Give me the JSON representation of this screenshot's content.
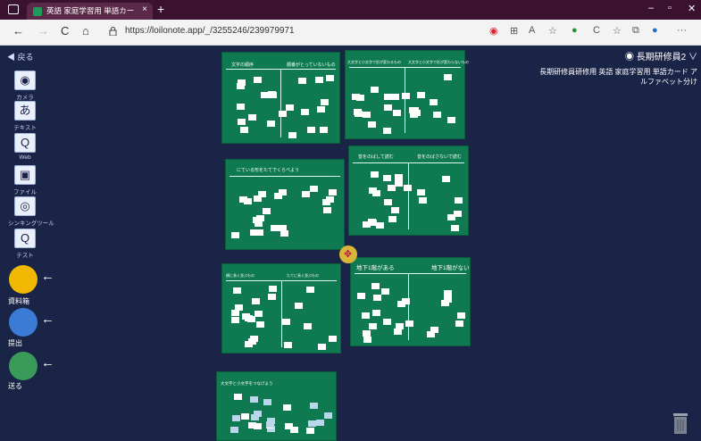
{
  "browser": {
    "tab_title": "英語 家庭学習用 単語カードア",
    "close_tab": "×",
    "new_tab": "+",
    "url": "https://loilonote.app/_/3255246/239979971",
    "window_controls": [
      "–",
      "▫",
      "✕"
    ],
    "nav": {
      "back": "←",
      "forward": "→",
      "reload": "C",
      "home": "⌂"
    },
    "toolbar_icons": [
      "tracking-icon",
      "grid-icon",
      "read-aloud-icon",
      "favorite-icon",
      "extension-icon",
      "refresh-icon",
      "favorites-bar-icon",
      "collections-icon",
      "profile-icon",
      "more-icon"
    ],
    "more_label": "···"
  },
  "app": {
    "back_label": "戻る",
    "tools": [
      {
        "label": "カメラ",
        "glyph": "◉",
        "icon": "camera-icon"
      },
      {
        "label": "テキスト",
        "glyph": "あ",
        "icon": "text-icon"
      },
      {
        "label": "Web",
        "glyph": "Q",
        "icon": "web-icon"
      },
      {
        "label": "ファイル",
        "glyph": "▣",
        "icon": "file-icon"
      },
      {
        "label": "シンキングツール",
        "glyph": "◎",
        "icon": "thinking-tool-icon"
      },
      {
        "label": "テスト",
        "glyph": "Q",
        "icon": "test-icon"
      }
    ],
    "actions": [
      {
        "label": "資料箱",
        "icon": "material-box-icon",
        "color": "#f0b800"
      },
      {
        "label": "提出",
        "icon": "submit-icon",
        "color": "#3a7bd5"
      },
      {
        "label": "送る",
        "icon": "send-icon",
        "color": "#3a9a5a"
      }
    ],
    "arrow_glyph": "←",
    "user_name": "長期研修員2",
    "user_chevron": "∨",
    "breadcrumb": "長期研修員研修用 英語 家庭学習用 単語カード アルファベット分け"
  },
  "cards": [
    {
      "headers": [
        "文字の順序",
        "順番がとっていないもの"
      ]
    },
    {
      "headers": [
        "大文字と小文字で形が変わるもの",
        "大文字と小文字で形が変わらないもの"
      ]
    },
    {
      "headers": [
        "にている形をたてでくらべよう"
      ]
    },
    {
      "headers": [
        "音をのばして読む",
        "音をのばさないで読む"
      ]
    },
    {
      "headers": [
        "横に長く並ぶもの",
        "たてに長く並ぶもの"
      ]
    },
    {
      "headers": [
        "地下1階がある",
        "地下1階がない"
      ]
    },
    {
      "headers": [
        "大文字と小文字をつなげよう"
      ]
    }
  ]
}
